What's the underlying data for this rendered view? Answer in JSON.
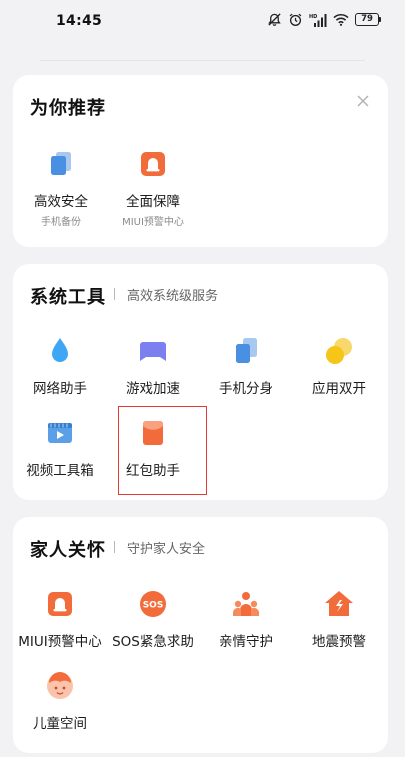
{
  "status_bar": {
    "time": "14:45",
    "battery": "79",
    "icons": [
      "no-alarm-icon",
      "alarm-clock-icon",
      "hd-signal-icon",
      "wifi-icon",
      "battery-icon"
    ]
  },
  "recommend": {
    "title": "为你推荐",
    "items": [
      {
        "label": "高效安全",
        "sublabel": "手机备份",
        "icon": "phone-backup-icon"
      },
      {
        "label": "全面保障",
        "sublabel": "MIUI预警中心",
        "icon": "alert-center-icon"
      }
    ]
  },
  "tools": {
    "title": "系统工具",
    "subtitle": "高效系统级服务",
    "items": [
      {
        "label": "网络助手",
        "icon": "water-drop-icon"
      },
      {
        "label": "游戏加速",
        "icon": "game-controller-icon"
      },
      {
        "label": "手机分身",
        "icon": "phone-clone-icon"
      },
      {
        "label": "应用双开",
        "icon": "dual-app-icon"
      },
      {
        "label": "视频工具箱",
        "icon": "video-toolbox-icon"
      },
      {
        "label": "红包助手",
        "icon": "red-envelope-icon"
      }
    ]
  },
  "family": {
    "title": "家人关怀",
    "subtitle": "守护家人安全",
    "items": [
      {
        "label": "MIUI预警中心",
        "icon": "alert-center-icon"
      },
      {
        "label": "SOS紧急求助",
        "icon": "sos-icon",
        "badge": "SOS"
      },
      {
        "label": "亲情守护",
        "icon": "family-guard-icon"
      },
      {
        "label": "地震预警",
        "icon": "earthquake-house-icon"
      },
      {
        "label": "儿童空间",
        "icon": "kid-space-icon"
      }
    ]
  },
  "colors": {
    "background": "#f2f2f4",
    "card": "#ffffff",
    "highlight": "#e53935",
    "orange": "#f26b3a",
    "blue": "#4a90e2",
    "purple": "#7b7ff0",
    "yellow": "#f5c518"
  }
}
